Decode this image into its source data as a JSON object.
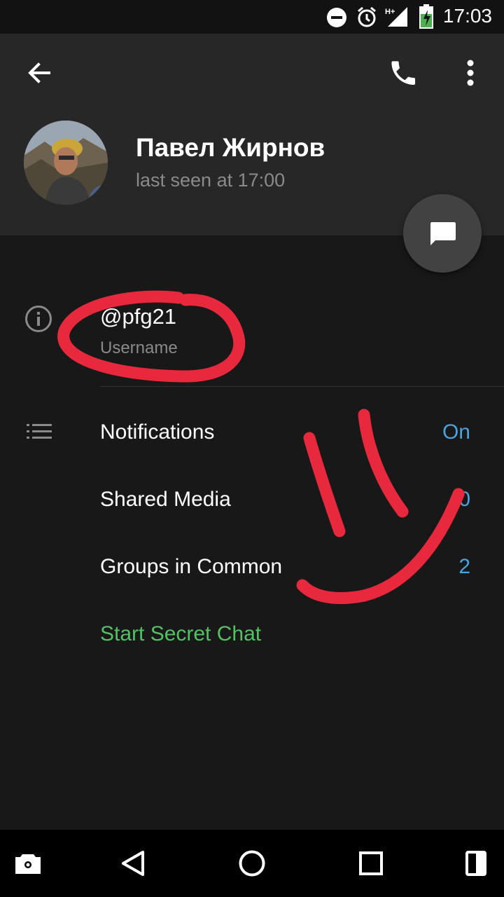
{
  "status_bar": {
    "time": "17:03",
    "icons": [
      "do-not-disturb-icon",
      "alarm-icon",
      "signal-h-plus-icon",
      "battery-charging-icon"
    ]
  },
  "header": {
    "icons": [
      "back-arrow-icon",
      "phone-icon",
      "more-vertical-icon"
    ],
    "name": "Павел Жирнов",
    "last_seen": "last seen at 17:00",
    "fab_icon": "message-icon"
  },
  "info": {
    "icon": "info-icon",
    "username": "@pfg21",
    "username_label": "Username"
  },
  "rows": [
    {
      "label": "Notifications",
      "value": "On",
      "icon": "list-icon"
    },
    {
      "label": "Shared Media",
      "value": "0"
    },
    {
      "label": "Groups in Common",
      "value": "2"
    },
    {
      "label": "Start Secret Chat",
      "value": ""
    }
  ],
  "nav_bar": {
    "icons": [
      "screenshot-camera-icon",
      "back-triangle-icon",
      "home-circle-icon",
      "recents-square-icon",
      "split-screen-icon"
    ]
  },
  "colors": {
    "accent": "#4aa3df",
    "secret": "#52c163",
    "annotation": "#e8283c"
  }
}
